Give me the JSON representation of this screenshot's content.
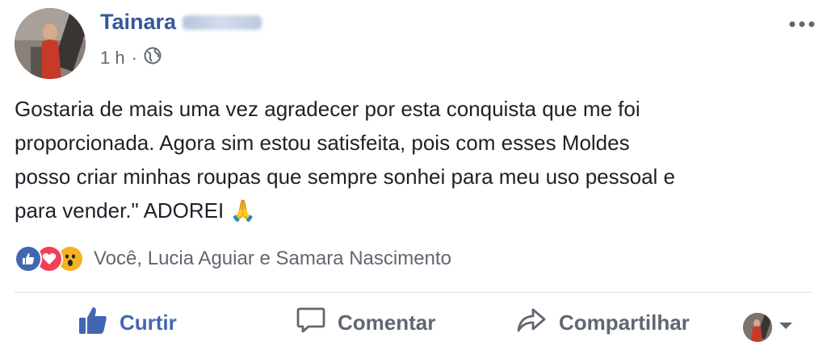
{
  "post": {
    "author_name": "Tainara",
    "timestamp": "1 h",
    "separator": "·",
    "body": "Gostaria de mais uma vez agradecer por esta conquista que me foi\nproporcionada. Agora sim estou satisfeita, pois com esses Moldes\nposso criar minhas roupas que sempre sonhei para meu uso pessoal e\npara vender.\" ADOREI",
    "emoji": "🙏",
    "reactions_text": "Você, Lucia Aguiar e Samara Nascimento"
  },
  "actions": {
    "like": "Curtir",
    "comment": "Comentar",
    "share": "Compartilhar"
  },
  "colors": {
    "name": "#365899",
    "like_blue": "#4267b2",
    "secondary": "#606770",
    "text": "#1d2129",
    "love_red": "#f33e58",
    "wow_yellow": "#f7b125"
  },
  "icons": [
    "globe-icon",
    "more-options-icon",
    "like-reaction-icon",
    "love-reaction-icon",
    "wow-reaction-icon",
    "thumbs-up-icon",
    "comment-bubble-icon",
    "share-arrow-icon",
    "dropdown-caret-icon"
  ]
}
